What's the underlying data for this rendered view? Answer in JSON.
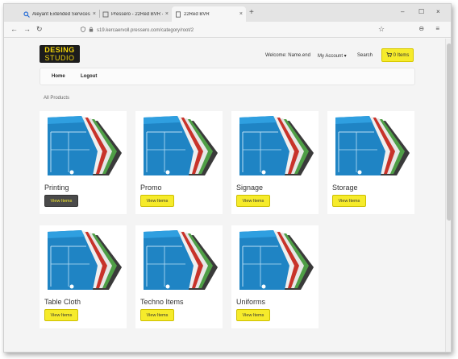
{
  "browser": {
    "tabs": [
      {
        "title": "Aleyant Extended Services",
        "close": "×",
        "icon": "search-icon"
      },
      {
        "title": "Pressero - 22Red BVR - Sh",
        "close": "×",
        "icon": "document-icon"
      },
      {
        "title": "22Red BVR",
        "close": "×",
        "icon": "document-icon"
      }
    ],
    "new_tab": "+",
    "window_controls": {
      "minimize": "–",
      "maximize": "☐",
      "close": "×"
    },
    "nav": {
      "back": "←",
      "forward": "→",
      "reload": "↻"
    },
    "url": "s19.kercaervoll.pressero.com/category/root/2",
    "bookmark": "☆",
    "extensions": "⊖ ≡"
  },
  "site": {
    "logo": {
      "line1": "DESING",
      "line2": "STUDIO"
    },
    "welcome": "Welcome: Name.end",
    "my_account": "My Account ▾",
    "search": "Search",
    "cart": "0 Items",
    "menu": {
      "home": "Home",
      "logout": "Logout"
    },
    "section_title": "All Products",
    "button_label": "View Items",
    "products": [
      {
        "name": "Printing"
      },
      {
        "name": "Promo"
      },
      {
        "name": "Signage"
      },
      {
        "name": "Storage"
      },
      {
        "name": "Table Cloth"
      },
      {
        "name": "Techno Items"
      },
      {
        "name": "Uniforms"
      }
    ]
  },
  "colors": {
    "accent_yellow": "#f6eb2b",
    "logo_bg": "#1c1c1c",
    "active_button": "#4a4a4a"
  }
}
